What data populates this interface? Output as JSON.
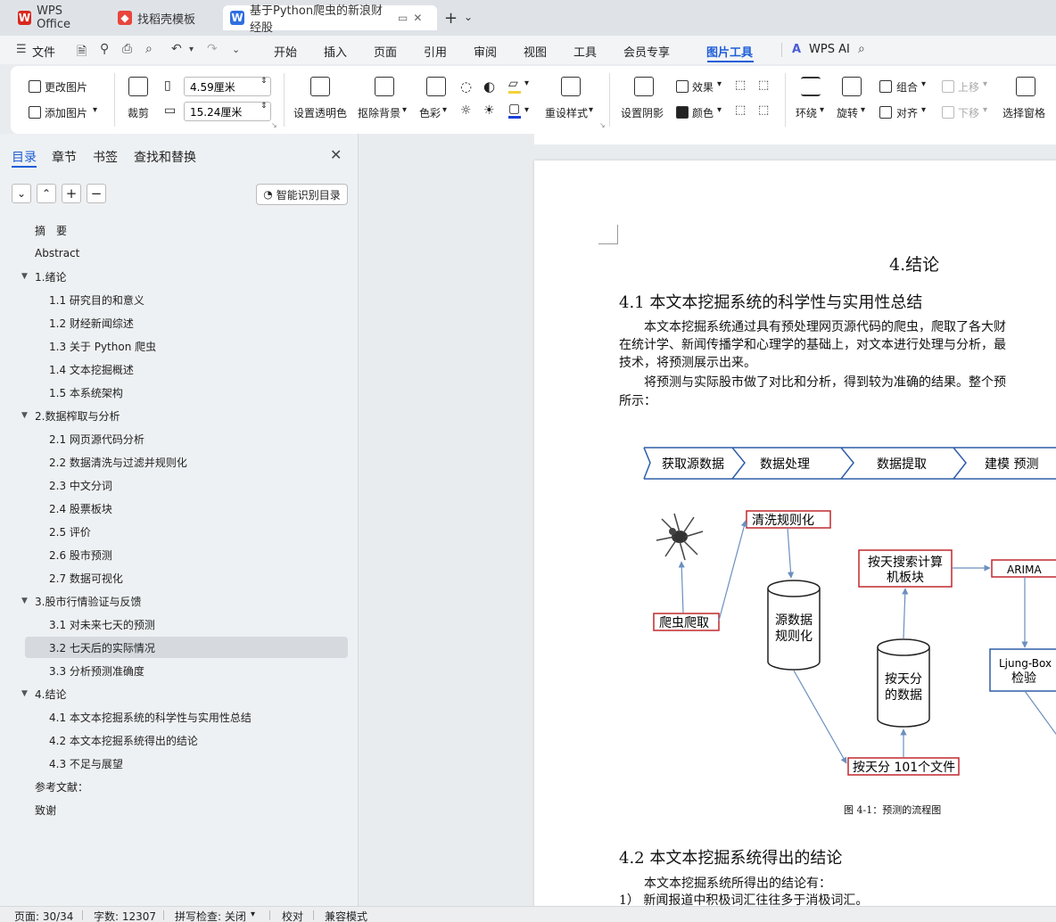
{
  "tabs": [
    {
      "label": "WPS Office"
    },
    {
      "label": "找稻壳模板"
    },
    {
      "label": "基于Python爬虫的新浪财经股"
    }
  ],
  "menu": {
    "file": "文件",
    "items": [
      "开始",
      "插入",
      "页面",
      "引用",
      "审阅",
      "视图",
      "工具",
      "会员专享",
      "图片工具"
    ],
    "active": "图片工具",
    "wps_ai": "WPS AI"
  },
  "ribbon": {
    "change_image": "更改图片",
    "add_image": "添加图片",
    "crop": "裁剪",
    "height_value": "4.59厘米",
    "width_value": "15.24厘米",
    "set_transparent": "设置透明色",
    "remove_bg": "抠除背景",
    "color": "色彩",
    "preset_style": "重设样式",
    "set_shadow": "设置阴影",
    "effect": "效果",
    "fill_color": "颜色",
    "wrap": "环绕",
    "rotate": "旋转",
    "group": "组合",
    "align": "对齐",
    "bring_forward": "上移",
    "send_backward": "下移",
    "select_pane": "选择窗格"
  },
  "nav": {
    "tabs": [
      "目录",
      "章节",
      "书签",
      "查找和替换"
    ],
    "smart_toc": "智能识别目录",
    "toc": [
      {
        "label": "摘　要",
        "level": 1,
        "caret": false
      },
      {
        "label": "Abstract",
        "level": 1,
        "caret": false
      },
      {
        "label": "1.绪论",
        "level": 1,
        "caret": true
      },
      {
        "label": "1.1  研究目的和意义",
        "level": 2,
        "caret": false
      },
      {
        "label": "1.2  财经新闻综述",
        "level": 2,
        "caret": false
      },
      {
        "label": "1.3  关于 Python 爬虫",
        "level": 2,
        "caret": false
      },
      {
        "label": "1.4  文本挖掘概述",
        "level": 2,
        "caret": false
      },
      {
        "label": "1.5 本系统架构",
        "level": 2,
        "caret": false
      },
      {
        "label": "2.数据榨取与分析",
        "level": 1,
        "caret": true
      },
      {
        "label": "2.1  网页源代码分析",
        "level": 2,
        "caret": false
      },
      {
        "label": "2.2  数据清洗与过滤并规则化",
        "level": 2,
        "caret": false
      },
      {
        "label": "2.3  中文分词",
        "level": 2,
        "caret": false
      },
      {
        "label": "2.4  股票板块",
        "level": 2,
        "caret": false
      },
      {
        "label": "2.5  评价",
        "level": 2,
        "caret": false
      },
      {
        "label": "2.6  股市预测",
        "level": 2,
        "caret": false
      },
      {
        "label": "2.7  数据可视化",
        "level": 2,
        "caret": false
      },
      {
        "label": "3.股市行情验证与反馈",
        "level": 1,
        "caret": true
      },
      {
        "label": "3.1  对未来七天的预测",
        "level": 2,
        "caret": false
      },
      {
        "label": "3.2  七天后的实际情况",
        "level": 2,
        "caret": false,
        "selected": true
      },
      {
        "label": "3.3  分析预测准确度",
        "level": 2,
        "caret": false
      },
      {
        "label": "4.结论",
        "level": 1,
        "caret": true
      },
      {
        "label": "4.1  本文本挖掘系统的科学性与实用性总结",
        "level": 2,
        "caret": false
      },
      {
        "label": "4.2  本文本挖掘系统得出的结论",
        "level": 2,
        "caret": false
      },
      {
        "label": "4.3  不足与展望",
        "level": 2,
        "caret": false
      },
      {
        "label": "参考文献：",
        "level": 1,
        "caret": false
      },
      {
        "label": "致谢",
        "level": 1,
        "caret": false
      }
    ]
  },
  "doc": {
    "chapter_title": "4.结论",
    "section1_title": "4.1  本文本挖掘系统的科学性与实用性总结",
    "para1_line1": "本文本挖掘系统通过具有预处理网页源代码的爬虫，爬取了各大财",
    "para1_line2": "在统计学、新闻传播学和心理学的基础上，对文本进行处理与分析，最",
    "para1_line3": "技术，将预测展示出来。",
    "para2_line1": "将预测与实际股市做了对比和分析，得到较为准确的结果。整个预",
    "para2_line2": "所示：",
    "flow": {
      "steps": [
        "获取源数据",
        "数据处理",
        "数据提取",
        "建模 预测"
      ],
      "clean": "清洗规则化",
      "crawler": "爬虫爬取",
      "db1_line1": "源数据",
      "db1_line2": "规则化",
      "search_line1": "按天搜索计算",
      "search_line2": "机板块",
      "arima": "ARIMA",
      "db2_line1": "按天分",
      "db2_line2": "的数据",
      "ljung_line1": "Ljung-Box",
      "ljung_line2": "检验",
      "files": "按天分 101个文件"
    },
    "figure_caption": "图 4-1：预测的流程图",
    "section2_title": "4.2  本文本挖掘系统得出的结论",
    "para3_line1": "本文本挖掘系统所得出的结论有：",
    "para3_line2": "1）  新闻报道中积极词汇往往多于消极词汇。"
  },
  "status": {
    "page": "页面: 30/34",
    "words": "字数: 12307",
    "spell": "拼写检查: 关闭",
    "proof": "校对",
    "compat": "兼容模式"
  },
  "colors": {
    "accent": "#1d5ed8",
    "flow_red": "#c0282d",
    "flow_blue": "#2e5ea8",
    "arrow": "#6b8fbf"
  }
}
